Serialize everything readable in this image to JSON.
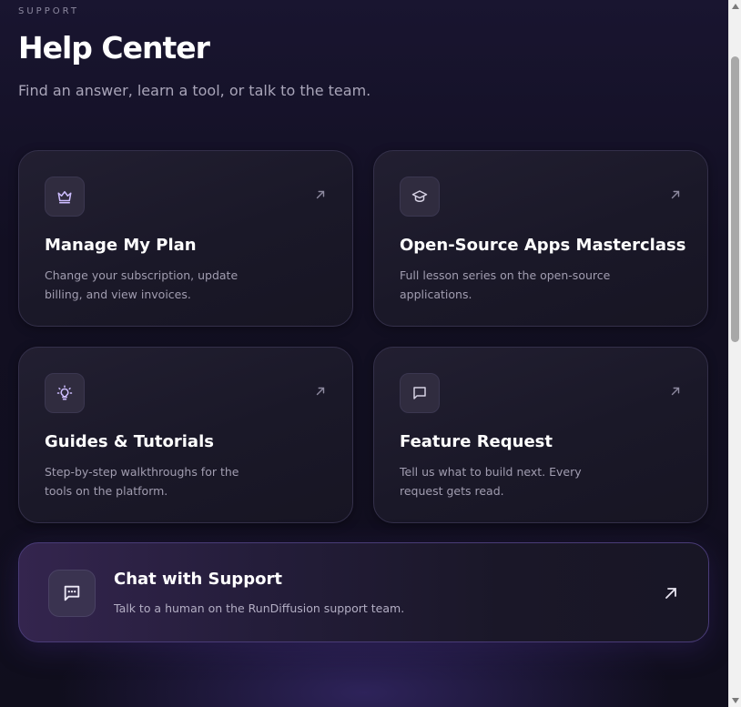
{
  "header": {
    "eyebrow": "SUPPORT",
    "title": "Help Center",
    "subtitle": "Find an answer, learn a tool, or talk to the team."
  },
  "cards": [
    {
      "title": "Manage My Plan",
      "description": "Change your subscription, update billing, and view invoices.",
      "icon": "crown-icon"
    },
    {
      "title": "Open-Source Apps Masterclass",
      "description": "Full lesson series on the open-source applications.",
      "icon": "graduation-cap-icon"
    },
    {
      "title": "Guides & Tutorials",
      "description": "Step-by-step walkthroughs for the tools on the platform.",
      "icon": "lightbulb-icon"
    },
    {
      "title": "Feature Request",
      "description": "Tell us what to build next. Every request gets read.",
      "icon": "message-square-icon"
    }
  ],
  "chat": {
    "title": "Chat with Support",
    "description": "Talk to a human on the RunDiffusion support team.",
    "icon": "chat-bubble-icon"
  },
  "colors": {
    "background": "#100e1d",
    "card": "#1c1a2a",
    "accent": "#c9b8ff",
    "chat_accent": "#34254e"
  }
}
